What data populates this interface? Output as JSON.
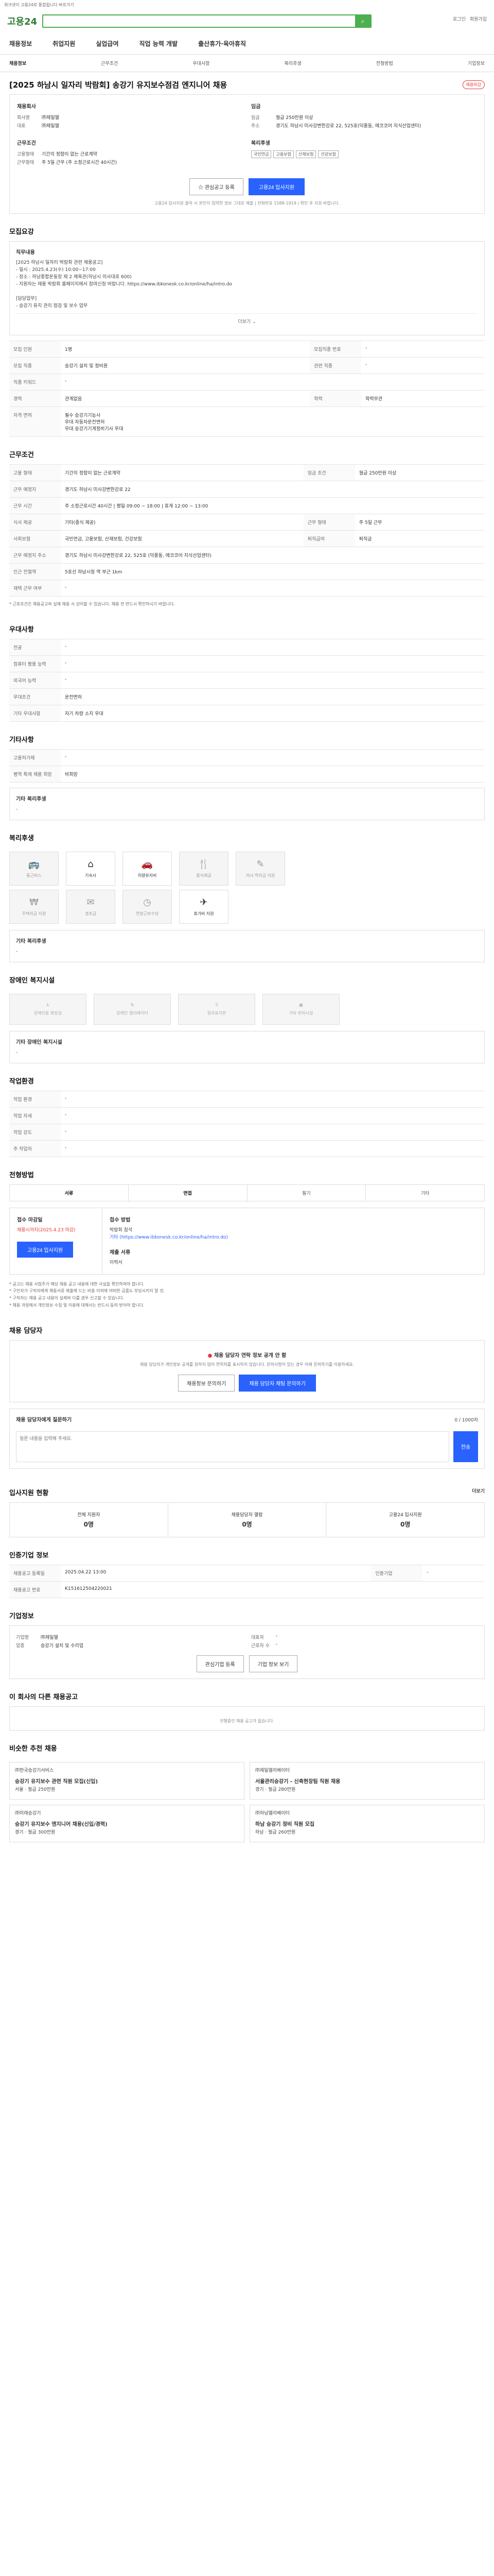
{
  "banner": "워크넷이 고용24로 통합됩니다 바로가기",
  "header": {
    "logo": "고용24",
    "search_placeholder": "",
    "util": [
      "로그인",
      "회원가입"
    ]
  },
  "gnb": [
    "채용정보",
    "취업지원",
    "실업급여",
    "직업 능력 개발",
    "출산휴가·육아휴직"
  ],
  "subnav": [
    "채용정보",
    "근무조건",
    "우대사항",
    "복리후생",
    "전형방법",
    "기업정보"
  ],
  "job": {
    "title": "[2025 하남시 일자리 박람회] 송강기 유지보수점검 엔지니어 채용",
    "badge": "채용마감",
    "company_h": "채용회사",
    "company": [
      {
        "k": "회사명",
        "v": "㈜제일엘"
      },
      {
        "k": "대표",
        "v": "㈜제일엘"
      }
    ],
    "conditions_h": "근무조건",
    "conditions": [
      {
        "k": "고용형태",
        "v": "기간의 정함이 없는 근로계약"
      },
      {
        "k": "근무형태",
        "v": "주 5일 근무 (주 소정근로시간 40시간)"
      }
    ],
    "salary_h": "임금",
    "salary": [
      {
        "k": "임금",
        "v": "월급 250만원 이상"
      },
      {
        "k": "주소",
        "v": "경기도 하남시 미사강변한강로 22, 525호(덕풍동, 에코코어 지식산업센터)"
      }
    ],
    "welfare_h": "복리후생",
    "welfare_tags": [
      "국민연금",
      "고용보험",
      "산재보험",
      "건강보험"
    ]
  },
  "actions": {
    "scrap": "관심공고 등록",
    "apply": "고용24 입사지원",
    "note": "고용24 입사지원 클릭 시 본인이 입력한 정보 그대로 제출 | 전화번호 1588-1919 | 확인 후 지원 바랍니다."
  },
  "recruit": {
    "h": "모집요강",
    "duty_h": "직무내용",
    "duty_lines": [
      "[2025 하남시 일자리 박람회 관련 채용공고]",
      "- 일시 : 2025.4.23(수) 10:00~17:00",
      "- 장소 : 하남종합운동장 제 2 체육관(하남시 미사대로 600)",
      "- 지원자는 채용 박람회 홈페이지에서 참여신청 바랍니다. https://www.ibkonesk.co.kr/online/ha/intro.do"
    ],
    "qual_h": "[담당업무]",
    "qual_lines": [
      "- 승강기 유지 관리 점검 및 보수 업무"
    ],
    "more": "더보기",
    "rows": [
      {
        "k": "모집 인원",
        "v": "1명",
        "k2": "모집직종 번호",
        "v2": "-"
      },
      {
        "k": "모집 직종",
        "v": "승강기 설치 및 정비원",
        "k2": "관련 직종",
        "v2": "-"
      },
      {
        "k": "직종 키워드",
        "v": "-",
        "k2": "",
        "v2": ""
      },
      {
        "k": "경력",
        "v": "관계없음",
        "k2": "학력",
        "v2": "학력무관"
      }
    ],
    "license_k": "자격 면허",
    "license": [
      "필수 승강기기능사",
      "우대 자동차운전면허",
      "우대 승강기기계정비기사 우대"
    ]
  },
  "work": {
    "h": "근무조건",
    "rows": [
      {
        "k": "고용 형태",
        "v": "기간의 정함이 없는 근로계약",
        "k2": "임금 조건",
        "v2": "월급 250만원 이상"
      },
      {
        "k": "근무 예정지",
        "v": "경기도 하남시 미사강변한강로 22",
        "k2": "",
        "v2": ""
      },
      {
        "k": "근무 시간",
        "v": "주 소정근로시간 40시간 | 평일 09:00 ~ 18:00 | 휴게 12:00 ~ 13:00",
        "k2": "",
        "v2": ""
      },
      {
        "k": "식사 제공",
        "v": "기타(중식 제공)",
        "k2": "근무 형태",
        "v2": "주 5일 근무"
      },
      {
        "k": "사회보험",
        "v": "국민연금, 고용보험, 산재보험, 건강보험",
        "k2": "퇴직급여",
        "v2": "퇴직금"
      },
      {
        "k": "근무 예정지 주소",
        "v": "경기도 하남시 미사강변한강로 22, 525호 (덕풍동, 에코코어 지식산업센터)",
        "k2": "",
        "v2": ""
      },
      {
        "k": "인근 전철역",
        "v": "5호선 하남시청 역 부근 1km",
        "k2": "",
        "v2": ""
      },
      {
        "k": "재택 근무 여부",
        "v": "-",
        "k2": "",
        "v2": ""
      }
    ],
    "note": "* 근로조건은 채용공고와 실제 채용 시 상이할 수 있습니다. 채용 전 반드시 확인하시기 바랍니다."
  },
  "prefer": {
    "h": "우대사항",
    "rows": [
      {
        "k": "전공",
        "v": "-"
      },
      {
        "k": "컴퓨터 활용 능력",
        "v": "-"
      },
      {
        "k": "외국어 능력",
        "v": "-"
      },
      {
        "k": "우대조건",
        "v": "운전면허"
      },
      {
        "k": "기타 우대사항",
        "v": "자기 차량 소지 우대"
      }
    ]
  },
  "extra": {
    "h": "기타사항",
    "rows": [
      {
        "k": "고용허가제",
        "v": "-"
      },
      {
        "k": "병역 특례 채용 희망",
        "v": "비희망"
      }
    ],
    "h2": "기타 복리후생",
    "v2": "-"
  },
  "benefits": {
    "h": "복리후생",
    "items": [
      {
        "name": "통근버스",
        "icon": "bus-icon",
        "on": false
      },
      {
        "name": "기숙사",
        "icon": "house-icon",
        "on": true
      },
      {
        "name": "차량유지비",
        "icon": "car-icon",
        "on": true
      },
      {
        "name": "중식제공",
        "icon": "meal-icon",
        "on": false
      },
      {
        "name": "자녀 학자금 지원",
        "icon": "school-icon",
        "on": false
      },
      {
        "name": "주택자금 지원",
        "icon": "money-icon",
        "on": false
      },
      {
        "name": "경조금",
        "icon": "gift-icon",
        "on": false
      },
      {
        "name": "연장근로수당",
        "icon": "clock-icon",
        "on": false
      },
      {
        "name": "휴가비 지원",
        "icon": "plane-icon",
        "on": true
      }
    ],
    "etc_h": "기타 복리후생",
    "etc_v": "-"
  },
  "disability": {
    "h": "장애인 복지시설",
    "items": [
      "장애인용 화장실",
      "장애인 엘리베이터",
      "점자표지판",
      "기타 편의시설"
    ],
    "etc_h": "기타 장애인 복지시설",
    "etc_v": "-"
  },
  "env": {
    "h": "작업환경",
    "rows": [
      {
        "k": "작업 환경",
        "v": "-",
        "k2": "",
        "v2": ""
      },
      {
        "k": "작업 자세",
        "v": "-",
        "k2": "",
        "v2": ""
      },
      {
        "k": "작업 강도",
        "v": "-",
        "k2": "",
        "v2": ""
      },
      {
        "k": "주 작업자",
        "v": "-",
        "k2": "",
        "v2": ""
      }
    ]
  },
  "process": {
    "h": "전형방법",
    "tabs": [
      "서류",
      "면접",
      "필기",
      "기타"
    ],
    "apply_h": "접수 마감일",
    "deadline": "채용시까지(2025.4.23 마감)",
    "method_h": "접수 방법",
    "method_lines": [
      "박람회 참석",
      "기타 (https://www.ibkonesk.co.kr/online/ha/intro.do)"
    ],
    "apply_btn": "고용24 입사지원",
    "doc_h": "제출 서류",
    "doc_v": "이력서",
    "notices": [
      "* 공고는 채용 사업주가 해당 채용 공고 내용에 대한 사실을 확인하여야 합니다.",
      "* 구인자가 구직자에게 채용서류 제출에 드는 비용 이외에 어떠한 금품도 부담시키지 말 것.",
      "* 구직자는 채용 공고 내용이 실제와 다를 경우 신고할 수 있습니다.",
      "* 채용 과정에서 개인정보 수집 및 이용에 대해서는 반드시 동의 받아야 합니다."
    ]
  },
  "consult": {
    "h": "채용 담당자",
    "warn": "채용 담당자 연락 정보 공개 안 함",
    "desc": "채용 담당자가 개인정보 공개를 원하지 않아 연락처를 표시하지 않습니다. 문의사항이 있는 경우 아래 문의하기를 이용하세요.",
    "btn1": "채용정보 문의하기",
    "btn2": "채용 담당자 채팅 문의하기"
  },
  "qa": {
    "h": "채용 담당자에게 질문하기",
    "placeholder": "질문 내용을 입력해 주세요.",
    "counter": "0 / 1000자",
    "btn": "전송"
  },
  "applicants": {
    "h": "입사지원 현황",
    "more": "더보기",
    "items": [
      {
        "label": "전체 지원자",
        "value": "0명"
      },
      {
        "label": "채용담당자 열람",
        "value": "0명"
      },
      {
        "label": "고용24 입사지원",
        "value": "0명"
      }
    ]
  },
  "related": {
    "h": "인증기업 정보",
    "rows": [
      {
        "k": "채용공고 등록일",
        "v": "2025.04.22 13:00",
        "k2": "인증기업",
        "v2": "-"
      },
      {
        "k": "채용공고 번호",
        "v": "K151612504220021",
        "k2": "",
        "v2": ""
      }
    ]
  },
  "company_info": {
    "h": "기업정보",
    "rows": [
      {
        "k": "기업명",
        "v": "㈜제일엘"
      },
      {
        "k": "업종",
        "v": "승강기 설치 및 수리업"
      },
      {
        "k": "대표자",
        "v": "-"
      },
      {
        "k": "근로자 수",
        "v": "-"
      }
    ],
    "btn1": "관심기업 등록",
    "btn2": "기업 정보 보기"
  },
  "recommend": {
    "h": "이 회사의 다른 채용공고",
    "note": "진행중인 채용 공고가 없습니다."
  },
  "similar": {
    "h": "비슷한 추천 채용",
    "items": [
      {
        "company": "㈜한국승강기서비스",
        "title": "승강기 유지보수 관련 직원 모집(신입)",
        "loc": "서울",
        "pay": "월급 250만원"
      },
      {
        "company": "㈜제일엘리베이터",
        "title": "서울관리승강기 - 신축현장팀 직원 채용",
        "loc": "경기",
        "pay": "월급 280만원"
      },
      {
        "company": "㈜미래승강기",
        "title": "승강기 유지보수 엔지니어 채용(신입/경력)",
        "loc": "경기",
        "pay": "월급 300만원"
      },
      {
        "company": "㈜하남엘리베이터",
        "title": "하남 승강기 정비 직원 모집",
        "loc": "하남",
        "pay": "월급 260만원"
      }
    ]
  }
}
